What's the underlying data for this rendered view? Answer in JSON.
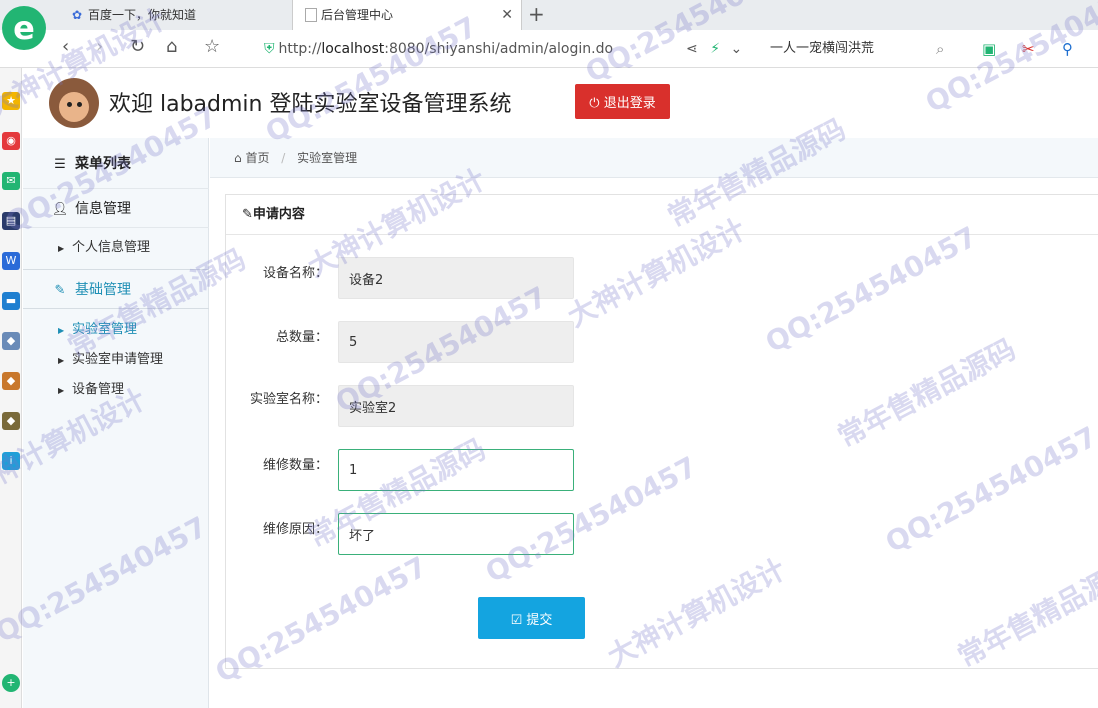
{
  "browser": {
    "logo_glyph": "e",
    "tabs": [
      {
        "label": "百度一下，你就知道",
        "icon": "baidu-paw-icon"
      },
      {
        "label": "后台管理中心",
        "icon": "page-icon"
      }
    ],
    "tab_close": "✕",
    "new_tab": "+",
    "address": {
      "scheme": "http://",
      "host": "localhost",
      "rest": ":8080/shiyanshi/admin/alogin.do"
    },
    "search_hint": "一人一宠横闯洪荒"
  },
  "header": {
    "title": "欢迎 labadmin 登陆实验室设备管理系统",
    "logout_label": "退出登录",
    "logout_color": "#d9302c"
  },
  "sidebar": {
    "menu_title": "菜单列表",
    "groups": [
      {
        "label": "信息管理",
        "icon": "user-icon",
        "items": [
          "个人信息管理"
        ]
      },
      {
        "label": "基础管理",
        "icon": "edit-icon",
        "items": [
          "实验室管理",
          "实验室申请管理",
          "设备管理"
        ]
      }
    ],
    "active_color": "#1f8fb5"
  },
  "breadcrumb": {
    "home": "首页",
    "current": "实验室管理"
  },
  "form": {
    "title": "申请内容",
    "fields": [
      {
        "label": "设备名称：",
        "value": "设备2",
        "readonly": true
      },
      {
        "label": "总数量：",
        "value": "5",
        "readonly": true
      },
      {
        "label": "实验室名称：",
        "value": "实验室2",
        "readonly": true
      },
      {
        "label": "维修数量：",
        "value": "1",
        "readonly": false
      },
      {
        "label": "维修原因：",
        "value": "坏了",
        "readonly": false
      }
    ],
    "submit_label": "提交",
    "submit_color": "#14a4e0"
  },
  "watermark": {
    "texts": [
      "QQ:254540457",
      "大神计算机设计",
      "常年售精品源码"
    ]
  }
}
